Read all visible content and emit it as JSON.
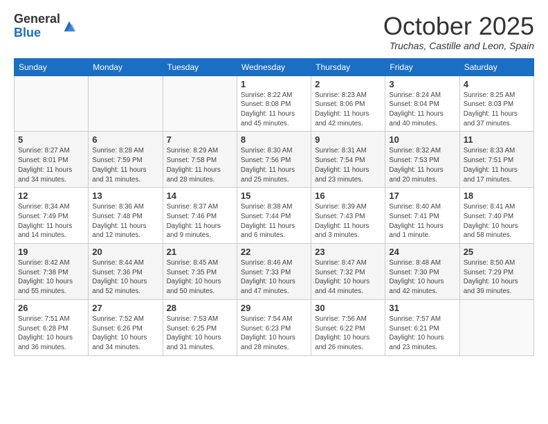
{
  "logo": {
    "general": "General",
    "blue": "Blue"
  },
  "header": {
    "month": "October 2025",
    "location": "Truchas, Castille and Leon, Spain"
  },
  "weekdays": [
    "Sunday",
    "Monday",
    "Tuesday",
    "Wednesday",
    "Thursday",
    "Friday",
    "Saturday"
  ],
  "days": [
    {
      "num": null,
      "info": null
    },
    {
      "num": null,
      "info": null
    },
    {
      "num": null,
      "info": null
    },
    {
      "num": "1",
      "info": "Sunrise: 8:22 AM\nSunset: 8:08 PM\nDaylight: 11 hours\nand 45 minutes."
    },
    {
      "num": "2",
      "info": "Sunrise: 8:23 AM\nSunset: 8:06 PM\nDaylight: 11 hours\nand 42 minutes."
    },
    {
      "num": "3",
      "info": "Sunrise: 8:24 AM\nSunset: 8:04 PM\nDaylight: 11 hours\nand 40 minutes."
    },
    {
      "num": "4",
      "info": "Sunrise: 8:25 AM\nSunset: 8:03 PM\nDaylight: 11 hours\nand 37 minutes."
    },
    {
      "num": "5",
      "info": "Sunrise: 8:27 AM\nSunset: 8:01 PM\nDaylight: 11 hours\nand 34 minutes."
    },
    {
      "num": "6",
      "info": "Sunrise: 8:28 AM\nSunset: 7:59 PM\nDaylight: 11 hours\nand 31 minutes."
    },
    {
      "num": "7",
      "info": "Sunrise: 8:29 AM\nSunset: 7:58 PM\nDaylight: 11 hours\nand 28 minutes."
    },
    {
      "num": "8",
      "info": "Sunrise: 8:30 AM\nSunset: 7:56 PM\nDaylight: 11 hours\nand 25 minutes."
    },
    {
      "num": "9",
      "info": "Sunrise: 8:31 AM\nSunset: 7:54 PM\nDaylight: 11 hours\nand 23 minutes."
    },
    {
      "num": "10",
      "info": "Sunrise: 8:32 AM\nSunset: 7:53 PM\nDaylight: 11 hours\nand 20 minutes."
    },
    {
      "num": "11",
      "info": "Sunrise: 8:33 AM\nSunset: 7:51 PM\nDaylight: 11 hours\nand 17 minutes."
    },
    {
      "num": "12",
      "info": "Sunrise: 8:34 AM\nSunset: 7:49 PM\nDaylight: 11 hours\nand 14 minutes."
    },
    {
      "num": "13",
      "info": "Sunrise: 8:36 AM\nSunset: 7:48 PM\nDaylight: 11 hours\nand 12 minutes."
    },
    {
      "num": "14",
      "info": "Sunrise: 8:37 AM\nSunset: 7:46 PM\nDaylight: 11 hours\nand 9 minutes."
    },
    {
      "num": "15",
      "info": "Sunrise: 8:38 AM\nSunset: 7:44 PM\nDaylight: 11 hours\nand 6 minutes."
    },
    {
      "num": "16",
      "info": "Sunrise: 8:39 AM\nSunset: 7:43 PM\nDaylight: 11 hours\nand 3 minutes."
    },
    {
      "num": "17",
      "info": "Sunrise: 8:40 AM\nSunset: 7:41 PM\nDaylight: 11 hours\nand 1 minute."
    },
    {
      "num": "18",
      "info": "Sunrise: 8:41 AM\nSunset: 7:40 PM\nDaylight: 10 hours\nand 58 minutes."
    },
    {
      "num": "19",
      "info": "Sunrise: 8:42 AM\nSunset: 7:38 PM\nDaylight: 10 hours\nand 55 minutes."
    },
    {
      "num": "20",
      "info": "Sunrise: 8:44 AM\nSunset: 7:36 PM\nDaylight: 10 hours\nand 52 minutes."
    },
    {
      "num": "21",
      "info": "Sunrise: 8:45 AM\nSunset: 7:35 PM\nDaylight: 10 hours\nand 50 minutes."
    },
    {
      "num": "22",
      "info": "Sunrise: 8:46 AM\nSunset: 7:33 PM\nDaylight: 10 hours\nand 47 minutes."
    },
    {
      "num": "23",
      "info": "Sunrise: 8:47 AM\nSunset: 7:32 PM\nDaylight: 10 hours\nand 44 minutes."
    },
    {
      "num": "24",
      "info": "Sunrise: 8:48 AM\nSunset: 7:30 PM\nDaylight: 10 hours\nand 42 minutes."
    },
    {
      "num": "25",
      "info": "Sunrise: 8:50 AM\nSunset: 7:29 PM\nDaylight: 10 hours\nand 39 minutes."
    },
    {
      "num": "26",
      "info": "Sunrise: 7:51 AM\nSunset: 6:28 PM\nDaylight: 10 hours\nand 36 minutes."
    },
    {
      "num": "27",
      "info": "Sunrise: 7:52 AM\nSunset: 6:26 PM\nDaylight: 10 hours\nand 34 minutes."
    },
    {
      "num": "28",
      "info": "Sunrise: 7:53 AM\nSunset: 6:25 PM\nDaylight: 10 hours\nand 31 minutes."
    },
    {
      "num": "29",
      "info": "Sunrise: 7:54 AM\nSunset: 6:23 PM\nDaylight: 10 hours\nand 28 minutes."
    },
    {
      "num": "30",
      "info": "Sunrise: 7:56 AM\nSunset: 6:22 PM\nDaylight: 10 hours\nand 26 minutes."
    },
    {
      "num": "31",
      "info": "Sunrise: 7:57 AM\nSunset: 6:21 PM\nDaylight: 10 hours\nand 23 minutes."
    },
    {
      "num": null,
      "info": null
    }
  ]
}
